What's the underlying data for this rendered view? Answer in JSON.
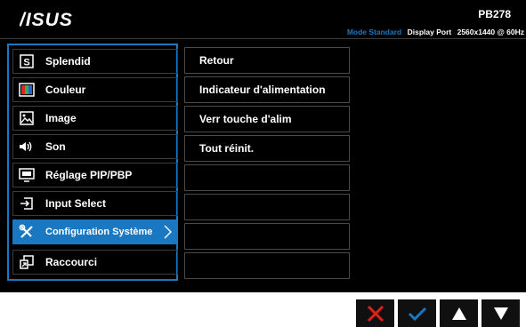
{
  "header": {
    "logo_text": "ASUS",
    "model": "PB278",
    "mode": "Mode Standard",
    "input": "Display Port",
    "resolution": "2560x1440 @ 60Hz"
  },
  "menu": {
    "items": [
      {
        "label": "Splendid",
        "icon": "splendid-s-icon"
      },
      {
        "label": "Couleur",
        "icon": "color-palette-icon"
      },
      {
        "label": "Image",
        "icon": "image-icon"
      },
      {
        "label": "Son",
        "icon": "speaker-icon"
      },
      {
        "label": "Réglage PIP/PBP",
        "icon": "pip-monitor-icon"
      },
      {
        "label": "Input Select",
        "icon": "input-arrow-icon"
      },
      {
        "label": "Configuration Système",
        "icon": "wrench-screwdriver-icon",
        "selected": true
      },
      {
        "label": "Raccourci",
        "icon": "shortcut-icon"
      }
    ]
  },
  "submenu": {
    "items": [
      "Retour",
      "Indicateur d'alimentation",
      "Verr touche d'alim",
      "Tout réinit.",
      "",
      "",
      "",
      ""
    ]
  },
  "buttons": [
    {
      "name": "close-button",
      "icon": "x-icon"
    },
    {
      "name": "confirm-button",
      "icon": "check-icon"
    },
    {
      "name": "up-button",
      "icon": "up-triangle-icon"
    },
    {
      "name": "down-button",
      "icon": "down-triangle-icon"
    }
  ],
  "colors": {
    "accent": "#1a78c2",
    "close": "#e0201c",
    "background": "#000000"
  }
}
